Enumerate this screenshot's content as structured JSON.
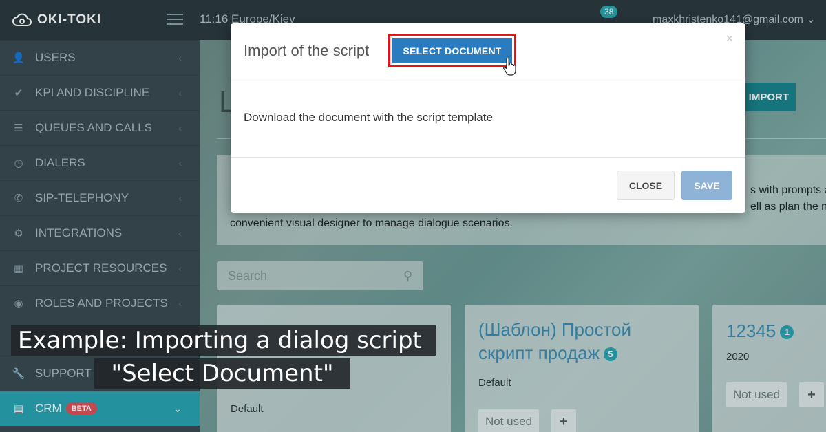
{
  "app": {
    "logo_text": "OKI-TOKI"
  },
  "topbar": {
    "time_zone": "11:16  Europe/Kiev",
    "notifications_count": "38",
    "user_email": "maxkhristenko141@gmail.com ⌄"
  },
  "sidebar": {
    "items": [
      {
        "label": "USERS",
        "icon": "user-icon",
        "glyph": "👤"
      },
      {
        "label": "KPI AND DISCIPLINE",
        "icon": "check-icon",
        "glyph": "✔"
      },
      {
        "label": "QUEUES AND CALLS",
        "icon": "list-icon",
        "glyph": "☰"
      },
      {
        "label": "DIALERS",
        "icon": "clock-icon",
        "glyph": "◷"
      },
      {
        "label": "SIP-TELEPHONY",
        "icon": "phone-icon",
        "glyph": "✆"
      },
      {
        "label": "INTEGRATIONS",
        "icon": "gears-icon",
        "glyph": "⚙"
      },
      {
        "label": "PROJECT RESOURCES",
        "icon": "grid-icon",
        "glyph": "▦"
      },
      {
        "label": "ROLES AND PROJECTS",
        "icon": "toggle-icon",
        "glyph": "◉"
      },
      {
        "label": "SUPPORT",
        "icon": "wrench-icon",
        "glyph": "🔧"
      },
      {
        "label": "CRM",
        "icon": "crm-icon",
        "glyph": "▤",
        "badge": "BETA"
      }
    ]
  },
  "main": {
    "page_heading_fragment": "L",
    "import_button_fragment": "IMPORT",
    "description_fragments": [
      "s with prompts a",
      "ell as plan the n",
      "convenient visual designer to manage dialogue scenarios."
    ],
    "search_placeholder": "Search",
    "cards": [
      {
        "title_fragment": "",
        "subtitle": "Default"
      },
      {
        "title": "(Шаблон) Простой скрипт продаж",
        "badge": "5",
        "subtitle": "Default",
        "status": "Not used"
      },
      {
        "title": "12345",
        "badge": "1",
        "subtitle": "2020",
        "status": "Not used"
      }
    ]
  },
  "modal": {
    "title": "Import of the script",
    "select_document_label": "SELECT DOCUMENT",
    "body_text": "Download the document with the script template",
    "close_label": "CLOSE",
    "save_label": "SAVE",
    "close_glyph": "×"
  },
  "captions": {
    "line1": "Example: Importing a dialog script",
    "line2": "\"Select Document\""
  },
  "colors": {
    "accent": "#2aa7b4",
    "primary_button": "#2a7bbf",
    "highlight_border": "#e8101a",
    "beta": "#e0525b"
  }
}
